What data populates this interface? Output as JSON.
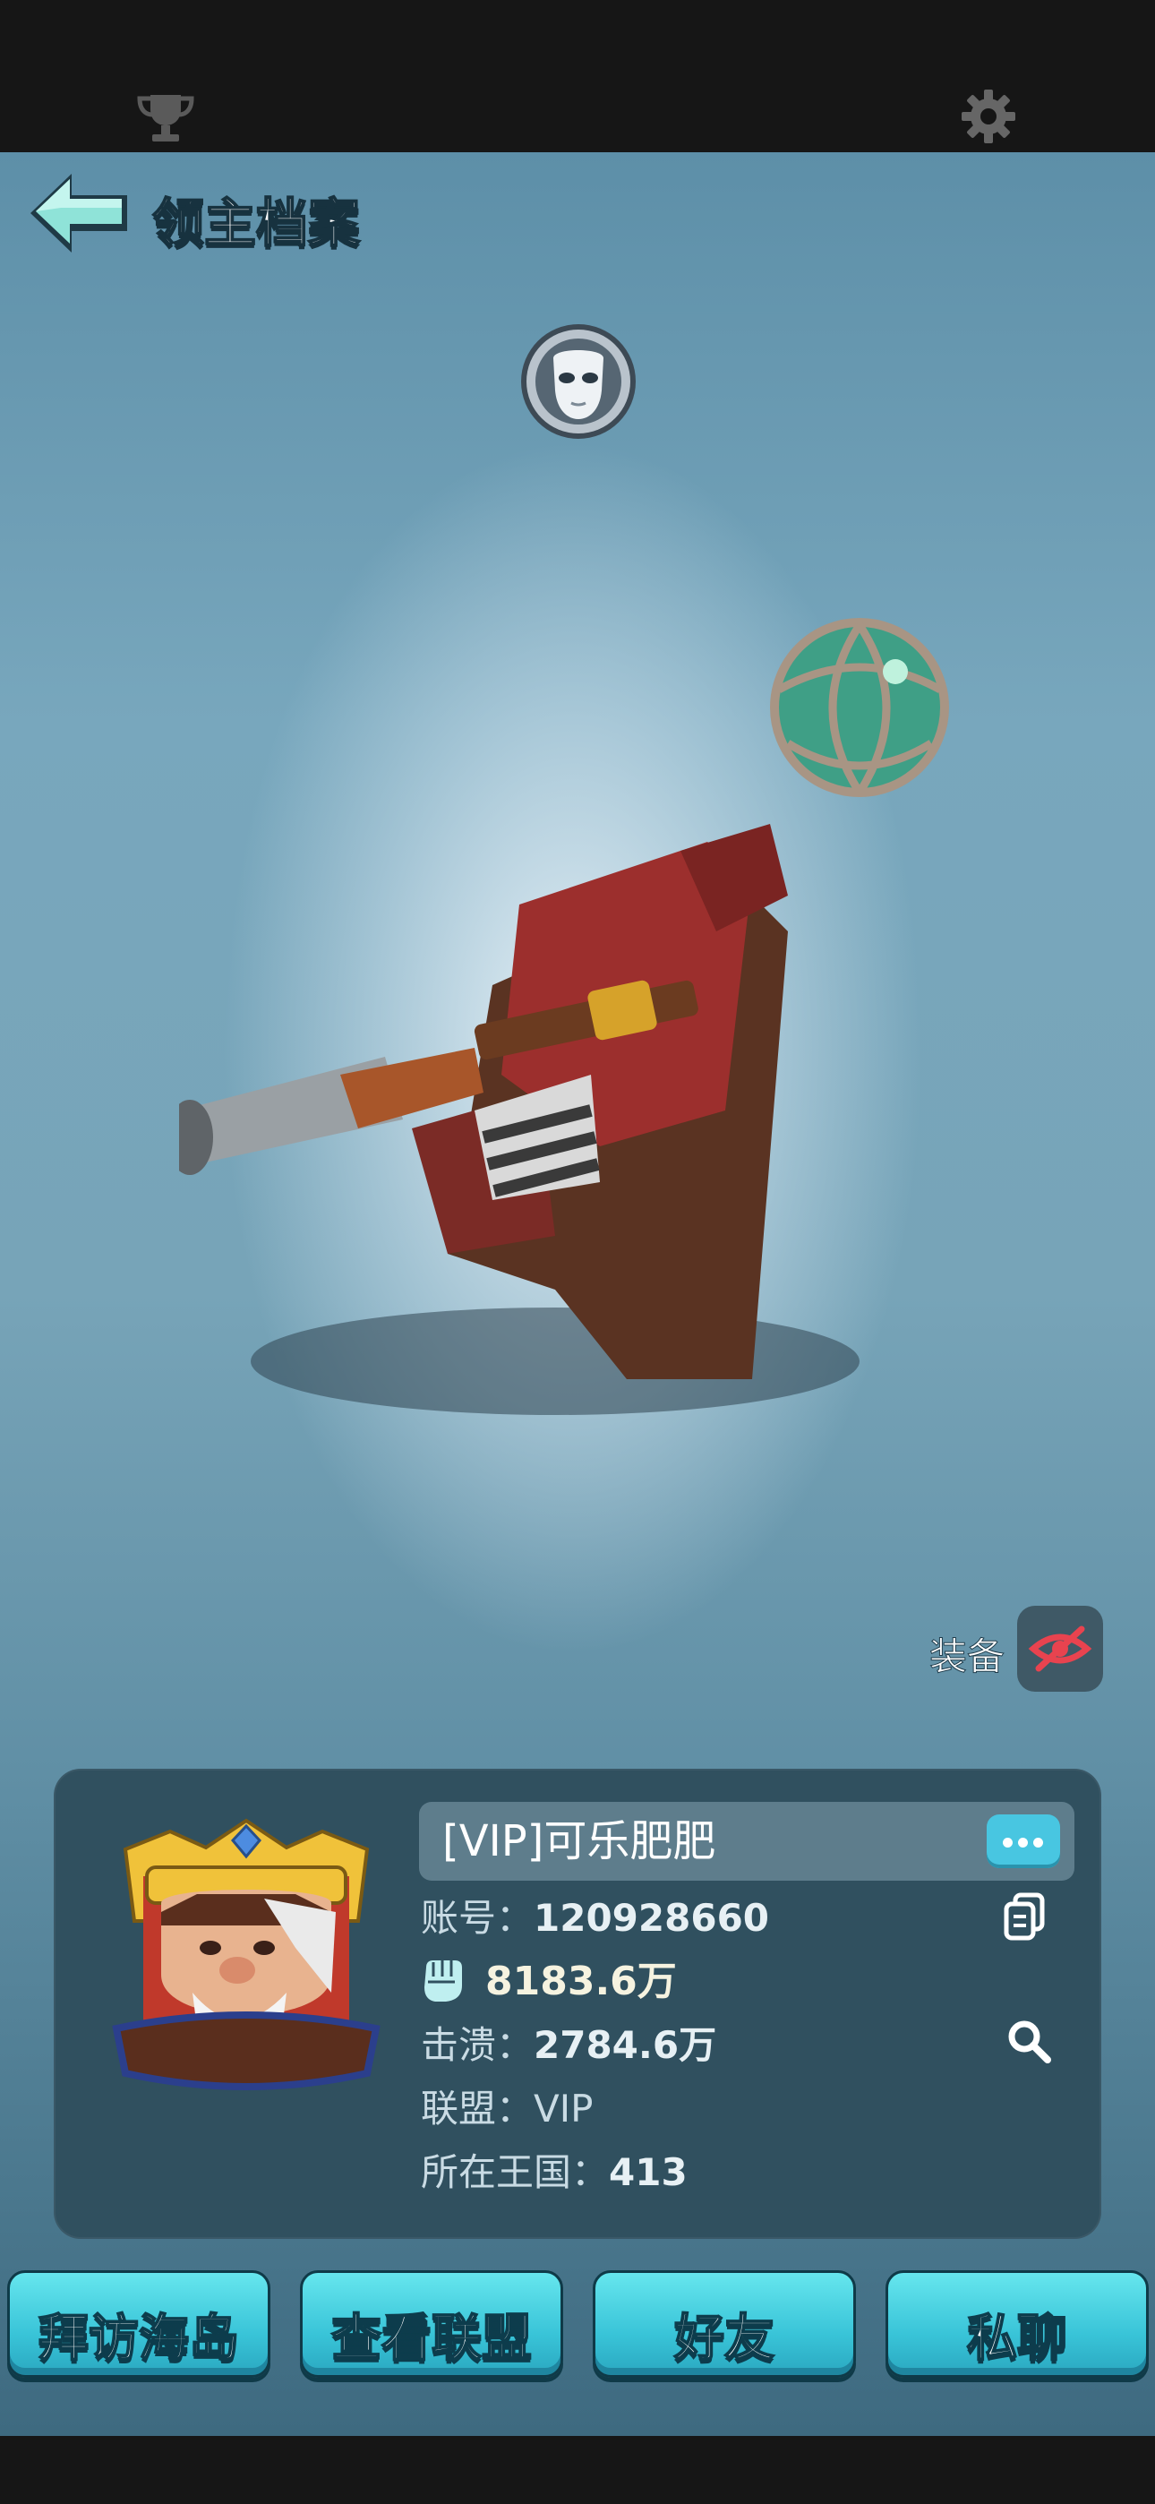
{
  "header": {
    "title": "领主档案"
  },
  "equip": {
    "label": "装备"
  },
  "profile": {
    "name": "[VIP]可乐肥肥",
    "account_label": "账号：",
    "account_id": "120928660",
    "power": "8183.6万",
    "kills_label": "击溃：",
    "kills": "2784.6万",
    "alliance_label": "联盟：",
    "alliance": "VIP",
    "kingdom_label": "所在王国：",
    "kingdom": "413"
  },
  "actions": [
    {
      "label": "拜访海岛"
    },
    {
      "label": "查看联盟"
    },
    {
      "label": "好友"
    },
    {
      "label": "私聊"
    }
  ],
  "colors": {
    "accent": "#48c6e1",
    "panel": "#30505f",
    "eye_off": "#e8434f"
  }
}
